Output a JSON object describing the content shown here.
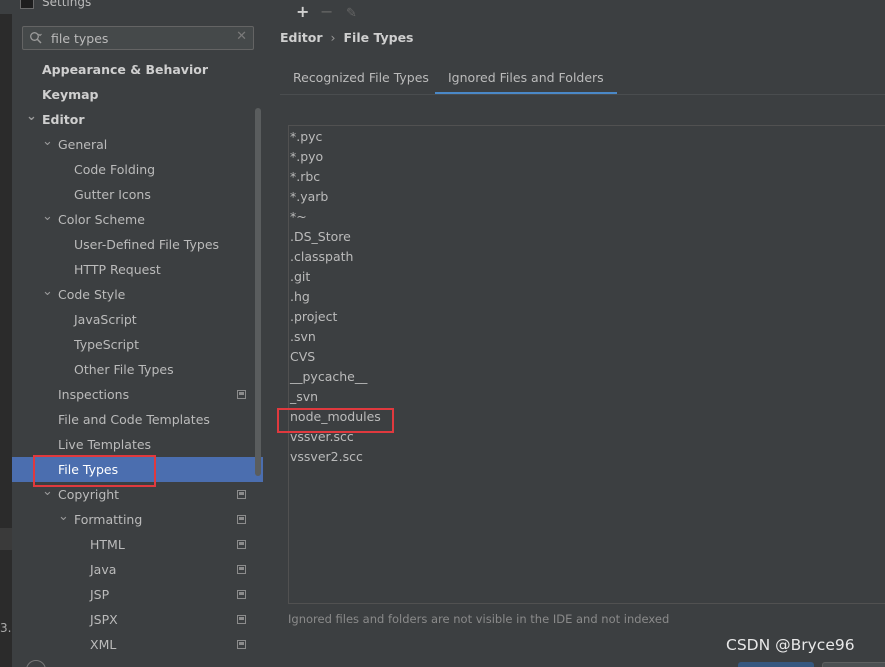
{
  "window": {
    "title": "Settings"
  },
  "search": {
    "value": "file types",
    "clear_glyph": "✕"
  },
  "sidebar": {
    "items": [
      {
        "label": "Appearance & Behavior",
        "level": 0,
        "bold": true,
        "expanded": null,
        "icon": null
      },
      {
        "label": "Keymap",
        "level": 0,
        "bold": true,
        "expanded": null,
        "icon": null
      },
      {
        "label": "Editor",
        "level": 0,
        "bold": true,
        "expanded": true,
        "icon": null
      },
      {
        "label": "General",
        "level": 1,
        "bold": false,
        "expanded": true,
        "icon": null
      },
      {
        "label": "Code Folding",
        "level": 2,
        "bold": false,
        "expanded": null,
        "icon": null
      },
      {
        "label": "Gutter Icons",
        "level": 2,
        "bold": false,
        "expanded": null,
        "icon": null
      },
      {
        "label": "Color Scheme",
        "level": 1,
        "bold": false,
        "expanded": true,
        "icon": null
      },
      {
        "label": "User-Defined File Types",
        "level": 2,
        "bold": false,
        "expanded": null,
        "icon": null
      },
      {
        "label": "HTTP Request",
        "level": 2,
        "bold": false,
        "expanded": null,
        "icon": null
      },
      {
        "label": "Code Style",
        "level": 1,
        "bold": false,
        "expanded": true,
        "icon": null
      },
      {
        "label": "JavaScript",
        "level": 2,
        "bold": false,
        "expanded": null,
        "icon": null
      },
      {
        "label": "TypeScript",
        "level": 2,
        "bold": false,
        "expanded": null,
        "icon": null
      },
      {
        "label": "Other File Types",
        "level": 2,
        "bold": false,
        "expanded": null,
        "icon": null
      },
      {
        "label": "Inspections",
        "level": 1,
        "bold": false,
        "expanded": null,
        "icon": "project-scope-icon"
      },
      {
        "label": "File and Code Templates",
        "level": 1,
        "bold": false,
        "expanded": null,
        "icon": null
      },
      {
        "label": "Live Templates",
        "level": 1,
        "bold": false,
        "expanded": null,
        "icon": null
      },
      {
        "label": "File Types",
        "level": 1,
        "bold": false,
        "expanded": null,
        "icon": null,
        "selected": true
      },
      {
        "label": "Copyright",
        "level": 1,
        "bold": false,
        "expanded": true,
        "icon": "project-scope-icon"
      },
      {
        "label": "Formatting",
        "level": 2,
        "bold": false,
        "expanded": true,
        "icon": "project-scope-icon",
        "chevron": true
      },
      {
        "label": "HTML",
        "level": 3,
        "bold": false,
        "expanded": null,
        "icon": "project-scope-icon"
      },
      {
        "label": "Java",
        "level": 3,
        "bold": false,
        "expanded": null,
        "icon": "project-scope-icon"
      },
      {
        "label": "JSP",
        "level": 3,
        "bold": false,
        "expanded": null,
        "icon": "project-scope-icon"
      },
      {
        "label": "JSPX",
        "level": 3,
        "bold": false,
        "expanded": null,
        "icon": "project-scope-icon"
      },
      {
        "label": "XML",
        "level": 3,
        "bold": false,
        "expanded": null,
        "icon": "project-scope-icon"
      }
    ]
  },
  "breadcrumb": {
    "parent": "Editor",
    "separator": "›",
    "current": "File Types"
  },
  "tabs": [
    {
      "label": "Recognized File Types",
      "active": false
    },
    {
      "label": "Ignored Files and Folders",
      "active": true
    }
  ],
  "toolbar": {
    "add_glyph": "+",
    "remove_glyph": "−",
    "edit_glyph": "✎"
  },
  "patterns": [
    "*.pyc",
    "*.pyo",
    "*.rbc",
    "*.yarb",
    "*~",
    ".DS_Store",
    ".classpath",
    ".git",
    ".hg",
    ".project",
    ".svn",
    "CVS",
    "__pycache__",
    "_svn",
    "node_modules",
    "vssver.scc",
    "vssver2.scc"
  ],
  "hint": "Ignored files and folders are not visible in the IDE and not indexed",
  "watermark": "CSDN @Bryce96",
  "left_edge_char": "3.",
  "colors": {
    "selection": "#4b6eaf",
    "accent_tab": "#4a88c7",
    "highlight_box": "#e0393e",
    "background": "#3c3f41"
  }
}
